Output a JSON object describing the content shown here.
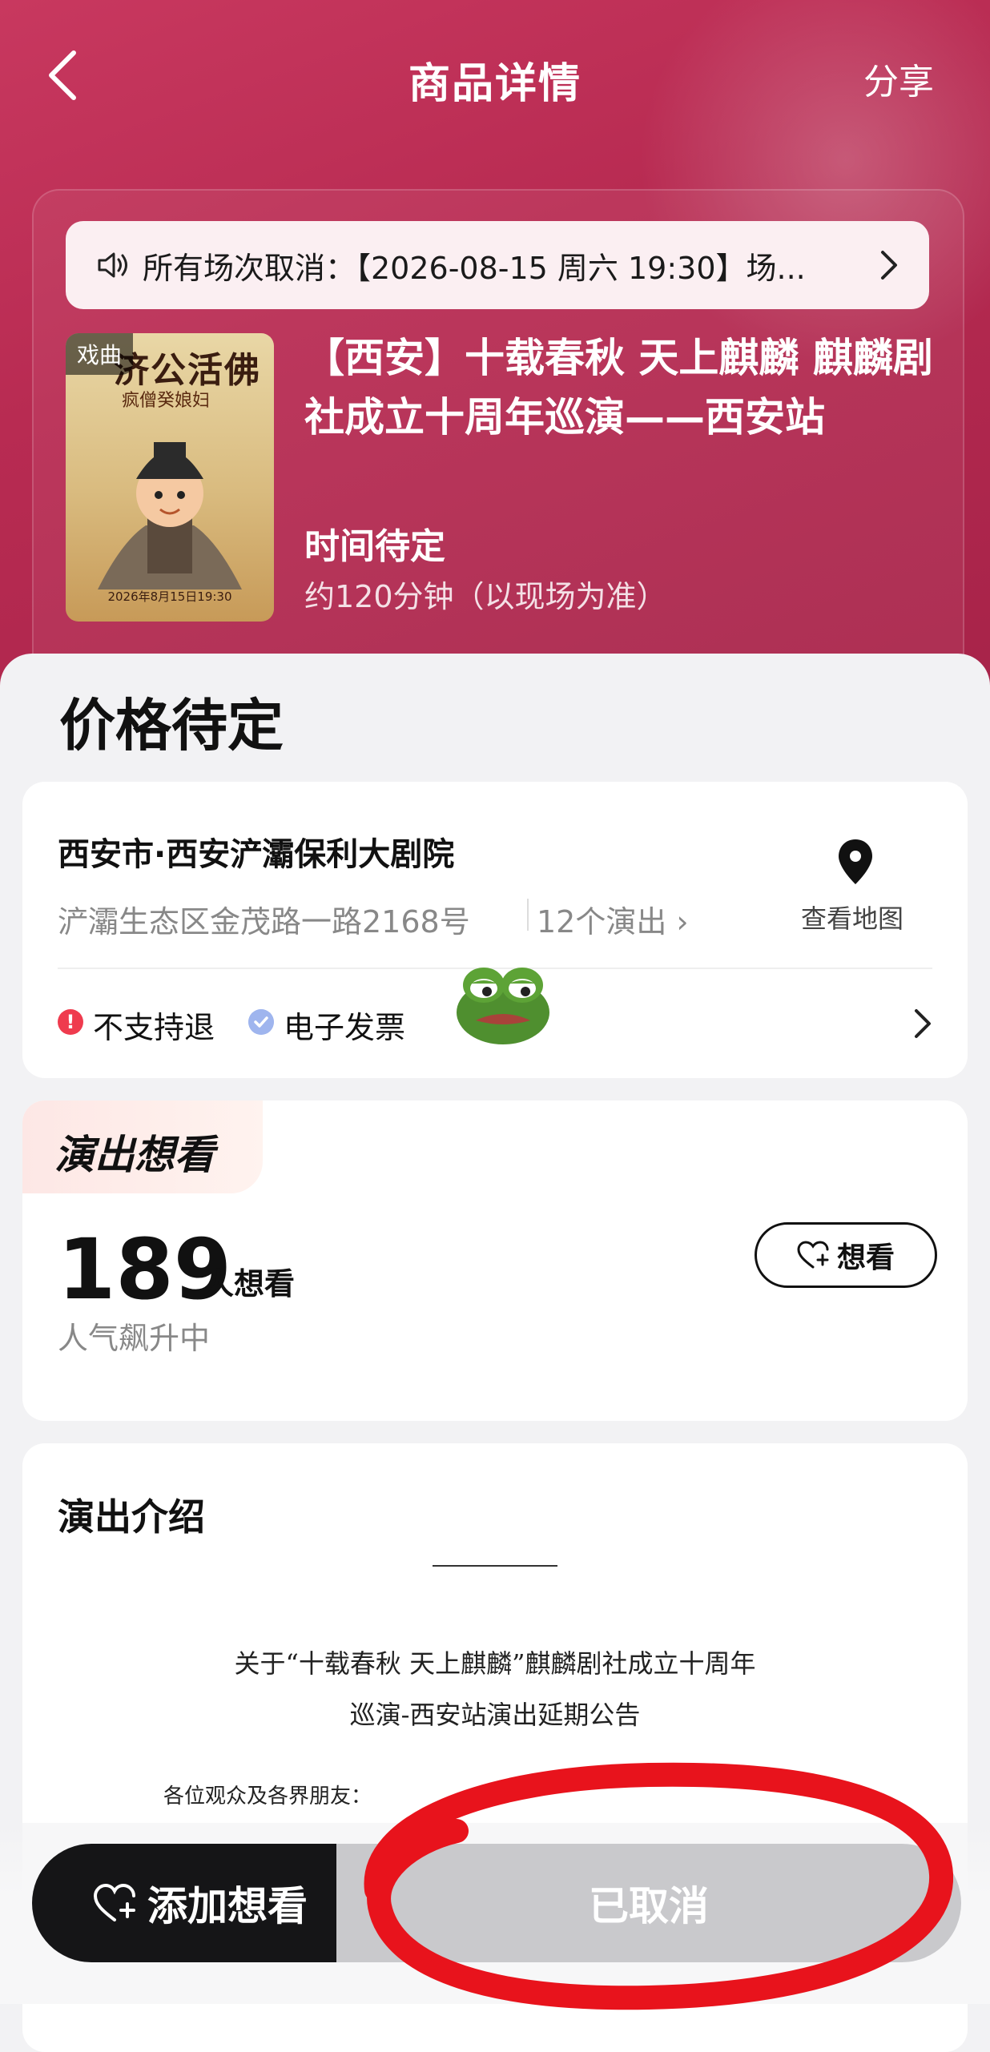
{
  "header": {
    "title": "商品详情",
    "share_label": "分享"
  },
  "notice": {
    "text": "所有场次取消：【2026-08-15 周六 19:30】场..."
  },
  "poster": {
    "tag": "戏曲",
    "title": "济公活佛",
    "subtitle": "疯僧癸娘妇",
    "date": "2026年8月15日19:30"
  },
  "show": {
    "title": "【西安】十载春秋 天上麒麟 麒麟剧社成立十周年巡演——西安站",
    "time": "时间待定",
    "duration": "约120分钟（以现场为准）"
  },
  "price": "价格待定",
  "venue": {
    "name": "西安市·西安浐灞保利大剧院",
    "address": "浐灞生态区金茂路一路2168号",
    "shows_count": "12个演出 ›",
    "map_label": "查看地图",
    "tag_no_refund": "不支持退",
    "tag_invoice": "电子发票"
  },
  "wishlist": {
    "badge": "演出想看",
    "count": "189",
    "unit": "人想看",
    "trend": "人气飙升中",
    "button_label": "想看"
  },
  "intro": {
    "title": "演出介绍",
    "announcement_line1": "关于“十载春秋 天上麒麟”麒麟剧社成立十周年",
    "announcement_line2": "巡演-西安站演出延期公告",
    "greeting": "各位观众及各界朋友："
  },
  "bottom": {
    "add_wish_label": "添加想看",
    "status_label": "已取消"
  },
  "colors": {
    "hero": "#b82b52",
    "annotation_red": "#e8131c",
    "disabled": "#c9c9cc"
  }
}
